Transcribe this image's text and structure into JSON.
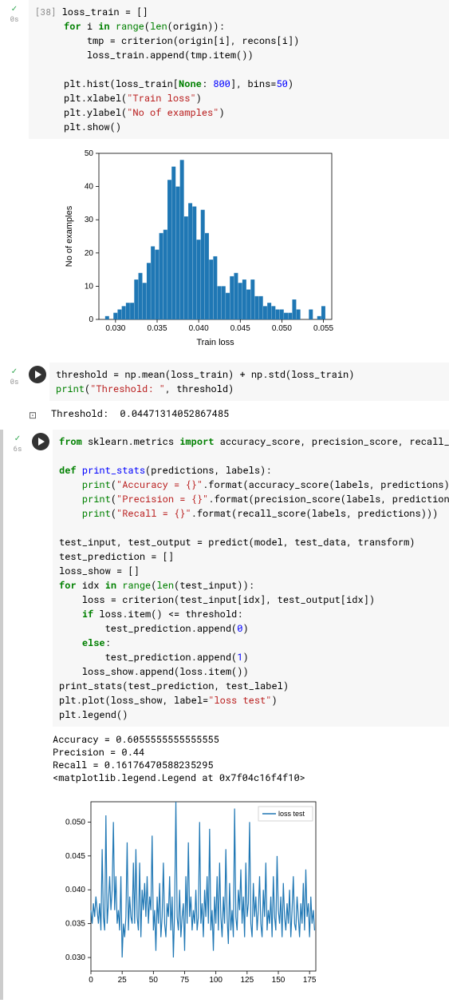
{
  "cell1": {
    "execCount": "[38]",
    "timing": "0s",
    "code": {
      "l1_a": "loss_train = []",
      "l2_a": "for",
      "l2_b": " i ",
      "l2_c": "in",
      "l2_d": " ",
      "l2_e": "range",
      "l2_f": "(",
      "l2_g": "len",
      "l2_h": "(origin)):",
      "l3_a": "    tmp = criterion(origin[i], recons[i])",
      "l4_a": "    loss_train.append(tmp.item())",
      "l6_a": "plt.hist(loss_train[",
      "l6_b": "None",
      "l6_c": ": ",
      "l6_d": "800",
      "l6_e": "], bins=",
      "l6_f": "50",
      "l6_g": ")",
      "l7_a": "plt.xlabel(",
      "l7_b": "\"Train loss\"",
      "l7_c": ")",
      "l8_a": "plt.ylabel(",
      "l8_b": "\"No of examples\"",
      "l8_c": ")",
      "l9_a": "plt.show()"
    }
  },
  "cell2": {
    "timing": "0s",
    "code": {
      "l1_a": "threshold = np.mean(loss_train) + np.std(loss_train)",
      "l2_a": "print",
      "l2_b": "(",
      "l2_c": "\"Threshold: \"",
      "l2_d": ", threshold)"
    },
    "output": "Threshold:  0.04471314052867485"
  },
  "cell3": {
    "timing": "6s",
    "code": {
      "l1_a": "from",
      "l1_b": " sklearn.metrics ",
      "l1_c": "import",
      "l1_d": " accuracy_score, precision_score, recall_score",
      "l3_a": "def",
      "l3_b": " ",
      "l3_c": "print_stats",
      "l3_d": "(predictions, labels):",
      "l4_a": "    ",
      "l4_b": "print",
      "l4_c": "(",
      "l4_d": "\"Accuracy = {}\"",
      "l4_e": ".format(accuracy_score(labels, predictions)))",
      "l5_a": "    ",
      "l5_b": "print",
      "l5_c": "(",
      "l5_d": "\"Precision = {}\"",
      "l5_e": ".format(precision_score(labels, predictions)))",
      "l6_a": "    ",
      "l6_b": "print",
      "l6_c": "(",
      "l6_d": "\"Recall = {}\"",
      "l6_e": ".format(recall_score(labels, predictions)))",
      "l8_a": "test_input, test_output = predict(model, test_data, transform)",
      "l9_a": "test_prediction = []",
      "l10_a": "loss_show = []",
      "l11_a": "for",
      "l11_b": " idx ",
      "l11_c": "in",
      "l11_d": " ",
      "l11_e": "range",
      "l11_f": "(",
      "l11_g": "len",
      "l11_h": "(test_input)):",
      "l12_a": "    loss = criterion(test_input[idx], test_output[idx])",
      "l13_a": "    ",
      "l13_b": "if",
      "l13_c": " loss.item() <= threshold:",
      "l14_a": "        test_prediction.append(",
      "l14_b": "0",
      "l14_c": ")",
      "l15_a": "    ",
      "l15_b": "else",
      "l15_c": ":",
      "l16_a": "        test_prediction.append(",
      "l16_b": "1",
      "l16_c": ")",
      "l17_a": "    loss_show.append(loss.item())",
      "l18_a": "print_stats(test_prediction, test_label)",
      "l19_a": "plt.plot(loss_show, label=",
      "l19_b": "\"loss test\"",
      "l19_c": ")",
      "l20_a": "plt.legend()"
    },
    "output": "Accuracy = 0.6055555555555555\nPrecision = 0.44\nRecall = 0.16176470588235295\n<matplotlib.legend.Legend at 0x7f04c16f4f10>"
  },
  "chart_data": [
    {
      "type": "bar",
      "title": "",
      "xlabel": "Train loss",
      "ylabel": "No of examples",
      "xlim": [
        0.028,
        0.056
      ],
      "ylim": [
        0,
        50
      ],
      "xticks": [
        0.03,
        0.035,
        0.04,
        0.045,
        0.05,
        0.055
      ],
      "yticks": [
        0,
        10,
        20,
        30,
        40,
        50
      ],
      "categories": [
        0.0285,
        0.029,
        0.0295,
        0.03,
        0.0305,
        0.031,
        0.0315,
        0.032,
        0.0325,
        0.033,
        0.0335,
        0.034,
        0.0345,
        0.035,
        0.0355,
        0.036,
        0.0365,
        0.037,
        0.0375,
        0.038,
        0.0385,
        0.039,
        0.0395,
        0.04,
        0.0405,
        0.041,
        0.0415,
        0.042,
        0.0425,
        0.043,
        0.0435,
        0.044,
        0.0445,
        0.045,
        0.0455,
        0.046,
        0.0465,
        0.047,
        0.0475,
        0.048,
        0.0485,
        0.049,
        0.0495,
        0.05,
        0.0505,
        0.051,
        0.0515,
        0.052,
        0.0525,
        0.053,
        0.0535,
        0.054,
        0.0545,
        0.055
      ],
      "values": [
        0,
        1,
        0,
        2,
        3,
        4,
        5,
        5,
        12,
        14,
        11,
        17,
        22,
        21,
        26,
        27,
        42,
        46,
        40,
        48,
        31,
        35,
        34,
        24,
        33,
        26,
        18,
        19,
        10,
        10,
        8,
        13,
        14,
        11,
        12,
        9,
        12,
        7,
        7,
        4,
        5,
        4,
        3,
        3,
        2,
        2,
        6,
        3,
        0,
        0,
        3,
        0,
        1,
        4
      ]
    },
    {
      "type": "line",
      "legend": "loss test",
      "legend_pos": "upper right",
      "xlabel": "",
      "ylabel": "",
      "xlim": [
        0,
        180
      ],
      "ylim": [
        0.028,
        0.053
      ],
      "xticks": [
        0,
        25,
        50,
        75,
        100,
        125,
        150,
        175
      ],
      "yticks": [
        0.03,
        0.035,
        0.04,
        0.045,
        0.05
      ],
      "x": [
        0,
        1,
        2,
        3,
        4,
        5,
        6,
        7,
        8,
        9,
        10,
        11,
        12,
        13,
        14,
        15,
        16,
        17,
        18,
        19,
        20,
        21,
        22,
        23,
        24,
        25,
        26,
        27,
        28,
        29,
        30,
        31,
        32,
        33,
        34,
        35,
        36,
        37,
        38,
        39,
        40,
        41,
        42,
        43,
        44,
        45,
        46,
        47,
        48,
        49,
        50,
        51,
        52,
        53,
        54,
        55,
        56,
        57,
        58,
        59,
        60,
        61,
        62,
        63,
        64,
        65,
        66,
        67,
        68,
        69,
        70,
        71,
        72,
        73,
        74,
        75,
        76,
        77,
        78,
        79,
        80,
        81,
        82,
        83,
        84,
        85,
        86,
        87,
        88,
        89,
        90,
        91,
        92,
        93,
        94,
        95,
        96,
        97,
        98,
        99,
        100,
        101,
        102,
        103,
        104,
        105,
        106,
        107,
        108,
        109,
        110,
        111,
        112,
        113,
        114,
        115,
        116,
        117,
        118,
        119,
        120,
        121,
        122,
        123,
        124,
        125,
        126,
        127,
        128,
        129,
        130,
        131,
        132,
        133,
        134,
        135,
        136,
        137,
        138,
        139,
        140,
        141,
        142,
        143,
        144,
        145,
        146,
        147,
        148,
        149,
        150,
        151,
        152,
        153,
        154,
        155,
        156,
        157,
        158,
        159,
        160,
        161,
        162,
        163,
        164,
        165,
        166,
        167,
        168,
        169,
        170,
        171,
        172,
        173,
        174,
        175,
        176,
        177,
        178,
        179
      ],
      "values": [
        0.037,
        0.035,
        0.038,
        0.036,
        0.039,
        0.037,
        0.035,
        0.038,
        0.034,
        0.046,
        0.036,
        0.034,
        0.051,
        0.035,
        0.038,
        0.042,
        0.037,
        0.04,
        0.05,
        0.037,
        0.042,
        0.035,
        0.037,
        0.034,
        0.042,
        0.03,
        0.035,
        0.033,
        0.036,
        0.047,
        0.034,
        0.039,
        0.036,
        0.035,
        0.044,
        0.035,
        0.046,
        0.036,
        0.034,
        0.044,
        0.033,
        0.04,
        0.037,
        0.041,
        0.036,
        0.042,
        0.035,
        0.039,
        0.037,
        0.048,
        0.034,
        0.037,
        0.031,
        0.039,
        0.035,
        0.041,
        0.033,
        0.036,
        0.044,
        0.035,
        0.033,
        0.038,
        0.036,
        0.042,
        0.034,
        0.039,
        0.03,
        0.037,
        0.053,
        0.036,
        0.034,
        0.04,
        0.033,
        0.036,
        0.038,
        0.031,
        0.042,
        0.035,
        0.047,
        0.036,
        0.039,
        0.034,
        0.037,
        0.035,
        0.04,
        0.034,
        0.036,
        0.05,
        0.035,
        0.038,
        0.033,
        0.04,
        0.036,
        0.042,
        0.035,
        0.049,
        0.034,
        0.037,
        0.031,
        0.039,
        0.035,
        0.042,
        0.034,
        0.044,
        0.036,
        0.033,
        0.039,
        0.035,
        0.046,
        0.036,
        0.032,
        0.041,
        0.034,
        0.037,
        0.033,
        0.052,
        0.036,
        0.034,
        0.04,
        0.037,
        0.043,
        0.035,
        0.039,
        0.033,
        0.044,
        0.036,
        0.038,
        0.05,
        0.035,
        0.033,
        0.041,
        0.036,
        0.039,
        0.034,
        0.037,
        0.042,
        0.035,
        0.033,
        0.04,
        0.036,
        0.044,
        0.034,
        0.037,
        0.035,
        0.039,
        0.033,
        0.042,
        0.036,
        0.034,
        0.045,
        0.037,
        0.035,
        0.039,
        0.033,
        0.041,
        0.036,
        0.034,
        0.038,
        0.035,
        0.04,
        0.033,
        0.037,
        0.042,
        0.035,
        0.034,
        0.039,
        0.036,
        0.033,
        0.038,
        0.035,
        0.041,
        0.034,
        0.043,
        0.036,
        0.038,
        0.033,
        0.039,
        0.035,
        0.037,
        0.034
      ]
    }
  ]
}
